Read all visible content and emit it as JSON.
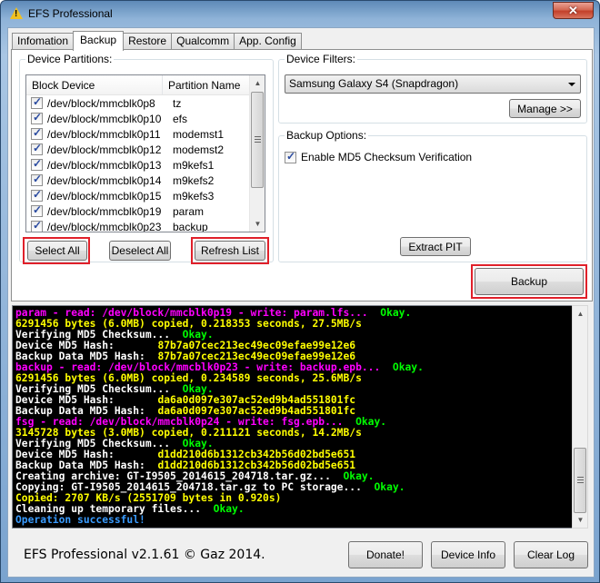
{
  "window": {
    "title": "EFS Professional",
    "close_label": "✕"
  },
  "tabs": [
    {
      "label": "Infomation",
      "active": false
    },
    {
      "label": "Backup",
      "active": true
    },
    {
      "label": "Restore",
      "active": false
    },
    {
      "label": "Qualcomm",
      "active": false
    },
    {
      "label": "App. Config",
      "active": false
    }
  ],
  "partitions": {
    "group_label": "Device Partitions:",
    "columns": [
      "Block Device",
      "Partition Name"
    ],
    "rows": [
      {
        "device": "/dev/block/mmcblk0p8",
        "name": "tz",
        "checked": true
      },
      {
        "device": "/dev/block/mmcblk0p10",
        "name": "efs",
        "checked": true
      },
      {
        "device": "/dev/block/mmcblk0p11",
        "name": "modemst1",
        "checked": true
      },
      {
        "device": "/dev/block/mmcblk0p12",
        "name": "modemst2",
        "checked": true
      },
      {
        "device": "/dev/block/mmcblk0p13",
        "name": "m9kefs1",
        "checked": true
      },
      {
        "device": "/dev/block/mmcblk0p14",
        "name": "m9kefs2",
        "checked": true
      },
      {
        "device": "/dev/block/mmcblk0p15",
        "name": "m9kefs3",
        "checked": true
      },
      {
        "device": "/dev/block/mmcblk0p19",
        "name": "param",
        "checked": true
      },
      {
        "device": "/dev/block/mmcblk0p23",
        "name": "backup",
        "checked": true
      }
    ],
    "select_all": "Select All",
    "deselect_all": "Deselect All",
    "refresh_list": "Refresh List"
  },
  "filters": {
    "group_label": "Device Filters:",
    "selected": "Samsung Galaxy S4 (Snapdragon)",
    "manage": "Manage >>"
  },
  "options": {
    "group_label": "Backup Options:",
    "md5_label": "Enable MD5 Checksum Verification",
    "md5_checked": true,
    "extract_pit": "Extract PIT"
  },
  "backup_button": "Backup",
  "log": [
    [
      [
        "m",
        "param - read: /dev/block/mmcblk0p19 - write: param.lfs...  "
      ],
      [
        "g",
        "Okay."
      ]
    ],
    [
      [
        "y",
        "6291456 bytes (6.0MB) copied, 0.218353 seconds, 27.5MB/s"
      ]
    ],
    [
      [
        "w",
        "Verifying MD5 Checksum...  "
      ],
      [
        "g",
        "Okay."
      ]
    ],
    [
      [
        "w",
        "Device MD5 Hash:       "
      ],
      [
        "y",
        "87b7a07cec213ec49ec09efae99e12e6"
      ]
    ],
    [
      [
        "w",
        "Backup Data MD5 Hash:  "
      ],
      [
        "y",
        "87b7a07cec213ec49ec09efae99e12e6"
      ]
    ],
    [
      [
        "m",
        "backup - read: /dev/block/mmcblk0p23 - write: backup.epb...  "
      ],
      [
        "g",
        "Okay."
      ]
    ],
    [
      [
        "y",
        "6291456 bytes (6.0MB) copied, 0.234589 seconds, 25.6MB/s"
      ]
    ],
    [
      [
        "w",
        "Verifying MD5 Checksum...  "
      ],
      [
        "g",
        "Okay."
      ]
    ],
    [
      [
        "w",
        "Device MD5 Hash:       "
      ],
      [
        "y",
        "da6a0d097e307ac52ed9b4ad551801fc"
      ]
    ],
    [
      [
        "w",
        "Backup Data MD5 Hash:  "
      ],
      [
        "y",
        "da6a0d097e307ac52ed9b4ad551801fc"
      ]
    ],
    [
      [
        "m",
        "fsg - read: /dev/block/mmcblk0p24 - write: fsg.epb...  "
      ],
      [
        "g",
        "Okay."
      ]
    ],
    [
      [
        "y",
        "3145728 bytes (3.0MB) copied, 0.211121 seconds, 14.2MB/s"
      ]
    ],
    [
      [
        "w",
        "Verifying MD5 Checksum...  "
      ],
      [
        "g",
        "Okay."
      ]
    ],
    [
      [
        "w",
        "Device MD5 Hash:       "
      ],
      [
        "y",
        "d1dd210d6b1312cb342b56d02bd5e651"
      ]
    ],
    [
      [
        "w",
        "Backup Data MD5 Hash:  "
      ],
      [
        "y",
        "d1dd210d6b1312cb342b56d02bd5e651"
      ]
    ],
    [
      [
        "w",
        "Creating archive: GT-I9505_2014615_204718.tar.gz...  "
      ],
      [
        "g",
        "Okay."
      ]
    ],
    [
      [
        "w",
        "Copying: GT-I9505_2014615_204718.tar.gz to PC storage...  "
      ],
      [
        "g",
        "Okay."
      ]
    ],
    [
      [
        "y",
        "Copied: 2707 KB/s (2551709 bytes in 0.920s)"
      ]
    ],
    [
      [
        "w",
        "Cleaning up temporary files...  "
      ],
      [
        "g",
        "Okay."
      ]
    ],
    [
      [
        "b",
        "Operation successful!"
      ]
    ]
  ],
  "footer": {
    "version": "EFS Professional v2.1.61 © Gaz 2014.",
    "donate": "Donate!",
    "device_info": "Device Info",
    "clear_log": "Clear Log"
  }
}
